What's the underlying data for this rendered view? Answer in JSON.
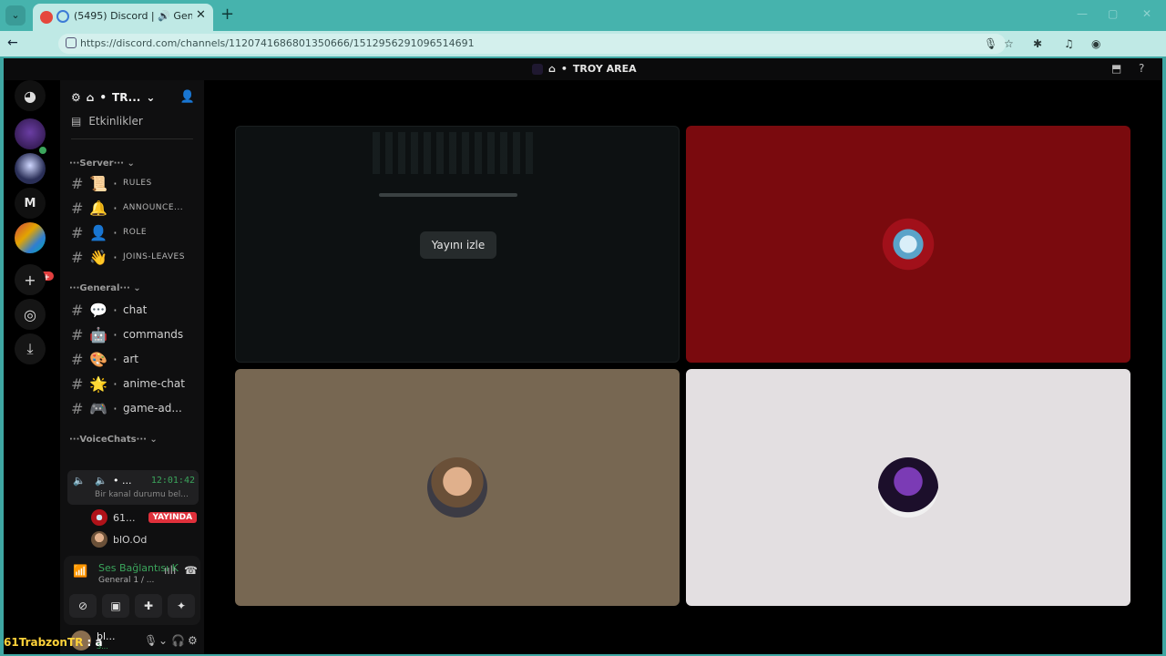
{
  "browser": {
    "tab_title": "(5495) Discord | 🔊 General",
    "url": "https://discord.com/channels/1120741686801350666/1512956291096514691"
  },
  "app": {
    "window_title": "TROY AREA"
  },
  "guilds": {
    "items": [
      {
        "name": "discord-home"
      },
      {
        "name": "server-1",
        "badge": ""
      },
      {
        "name": "server-2"
      },
      {
        "name": "server-m",
        "label": "M"
      },
      {
        "name": "server-folder",
        "badge": "5K+"
      }
    ]
  },
  "sidebar": {
    "server_name": "TR...",
    "events_label": "Etkinlikler",
    "category_server": "Server",
    "category_general": "General",
    "category_voice": "VoiceChats",
    "channels_server": [
      {
        "emoji": "📜",
        "label": "RULES"
      },
      {
        "emoji": "🔔",
        "label": "ANNOUNCE..."
      },
      {
        "emoji": "👤",
        "label": "ROLE"
      },
      {
        "emoji": "👋",
        "label": "JOINS-LEAVES"
      }
    ],
    "channels_general": [
      {
        "emoji": "💬",
        "label": "chat"
      },
      {
        "emoji": "🤖",
        "label": "commands"
      },
      {
        "emoji": "🎨",
        "label": "art"
      },
      {
        "emoji": "🌟",
        "label": "anime-chat"
      },
      {
        "emoji": "🎮",
        "label": "game-ad..."
      }
    ],
    "voice_channel": {
      "name": "...",
      "time": "12:01:42",
      "status": "Bir kanal durumu bel..."
    },
    "voice_users": [
      {
        "name": "61...",
        "live": "YAYINDA"
      },
      {
        "name": "blO.Od"
      }
    ]
  },
  "voice_panel": {
    "title": "Ses Bağlantısı K",
    "subtitle": "General 1 / ..."
  },
  "user": {
    "name": "bl...",
    "status": "S..."
  },
  "stage": {
    "watch_label": "Yayını izle"
  },
  "chat_overlay": {
    "user": "61TrabzonTR",
    "message": " : a"
  }
}
